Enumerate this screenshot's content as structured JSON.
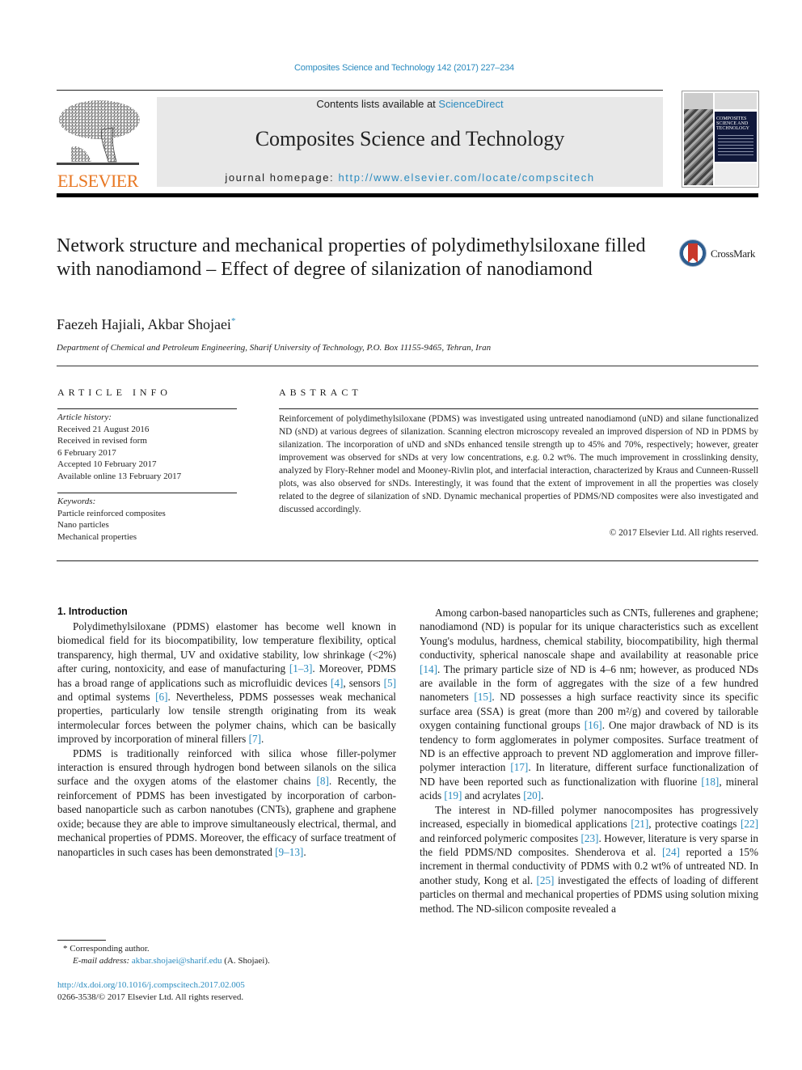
{
  "header": {
    "journal_reference": "Composites Science and Technology 142 (2017) 227–234",
    "publisher_logo_text": "ELSEVIER",
    "contents_prefix": "Contents lists available at ",
    "contents_link": "ScienceDirect",
    "journal_name": "Composites Science and Technology",
    "homepage_prefix": "journal homepage: ",
    "homepage_url": "http://www.elsevier.com/locate/compscitech",
    "cover_title": "COMPOSITES SCIENCE AND TECHNOLOGY"
  },
  "article": {
    "title": "Network structure and mechanical properties of polydimethylsiloxane filled with nanodiamond – Effect of degree of silanization of nanodiamond",
    "crossmark_label": "CrossMark",
    "authors": "Faezeh Hajiali, Akbar Shojaei",
    "author_mark": "*",
    "affiliation": "Department of Chemical and Petroleum Engineering, Sharif University of Technology, P.O. Box 11155-9465, Tehran, Iran"
  },
  "article_info": {
    "heading": "ARTICLE INFO",
    "history_label": "Article history:",
    "history": [
      "Received 21 August 2016",
      "Received in revised form",
      "6 February 2017",
      "Accepted 10 February 2017",
      "Available online 13 February 2017"
    ],
    "keywords_label": "Keywords:",
    "keywords": [
      "Particle reinforced composites",
      "Nano particles",
      "Mechanical properties"
    ]
  },
  "abstract": {
    "heading": "ABSTRACT",
    "text": "Reinforcement of polydimethylsiloxane (PDMS) was investigated using untreated nanodiamond (uND) and silane functionalized ND (sND) at various degrees of silanization. Scanning electron microscopy revealed an improved dispersion of ND in PDMS by silanization. The incorporation of uND and sNDs enhanced tensile strength up to 45% and 70%, respectively; however, greater improvement was observed for sNDs at very low concentrations, e.g. 0.2 wt%. The much improvement in crosslinking density, analyzed by Flory-Rehner model and Mooney-Rivlin plot, and interfacial interaction, characterized by Kraus and Cunneen-Russell plots, was also observed for sNDs. Interestingly, it was found that the extent of improvement in all the properties was closely related to the degree of silanization of sND. Dynamic mechanical properties of PDMS/ND composites were also investigated and discussed accordingly.",
    "copyright": "© 2017 Elsevier Ltd. All rights reserved."
  },
  "body": {
    "section_heading": "1.  Introduction",
    "col1_paragraphs": [
      [
        {
          "t": "Polydimethylsiloxane (PDMS) elastomer has become well known in biomedical field for its biocompatibility, low temperature flexibility, optical transparency, high thermal, UV and oxidative stability, low shrinkage (<2%) after curing, nontoxicity, and ease of manufacturing "
        },
        {
          "r": "[1–3]"
        },
        {
          "t": ". Moreover, PDMS has a broad range of applications such as microfluidic devices "
        },
        {
          "r": "[4]"
        },
        {
          "t": ", sensors "
        },
        {
          "r": "[5]"
        },
        {
          "t": " and optimal systems "
        },
        {
          "r": "[6]"
        },
        {
          "t": ". Nevertheless, PDMS possesses weak mechanical properties, particularly low tensile strength originating from its weak intermolecular forces between the polymer chains, which can be basically improved by incorporation of mineral fillers "
        },
        {
          "r": "[7]"
        },
        {
          "t": "."
        }
      ],
      [
        {
          "t": "PDMS is traditionally reinforced with silica whose filler-polymer interaction is ensured through hydrogen bond between silanols on the silica surface and the oxygen atoms of the elastomer chains "
        },
        {
          "r": "[8]"
        },
        {
          "t": ". Recently, the reinforcement of PDMS has been investigated by incorporation of carbon-based nanoparticle such as carbon nanotubes (CNTs), graphene and graphene oxide; because they are able to improve simultaneously electrical, thermal, and mechanical properties of PDMS. Moreover, the efficacy of surface treatment of nanoparticles in such cases has been demonstrated "
        },
        {
          "r": "[9–13]"
        },
        {
          "t": "."
        }
      ]
    ],
    "col2_paragraphs": [
      [
        {
          "t": "Among carbon-based nanoparticles such as CNTs, fullerenes and graphene; nanodiamond (ND) is popular for its unique characteristics such as excellent Young's modulus, hardness, chemical stability, biocompatibility, high thermal conductivity, spherical nanoscale shape and availability at reasonable price "
        },
        {
          "r": "[14]"
        },
        {
          "t": ". The primary particle size of ND is 4–6 nm; however, as produced NDs are available in the form of aggregates with the size of a few hundred nanometers "
        },
        {
          "r": "[15]"
        },
        {
          "t": ". ND possesses a high surface reactivity since its specific surface area (SSA) is great (more than 200 m²/g) and covered by tailorable oxygen containing functional groups "
        },
        {
          "r": "[16]"
        },
        {
          "t": ". One major drawback of ND is its tendency to form agglomerates in polymer composites. Surface treatment of ND is an effective approach to prevent ND agglomeration and improve filler-polymer interaction "
        },
        {
          "r": "[17]"
        },
        {
          "t": ". In literature, different surface functionalization of ND have been reported such as functionalization with fluorine "
        },
        {
          "r": "[18]"
        },
        {
          "t": ", mineral acids "
        },
        {
          "r": "[19]"
        },
        {
          "t": " and acrylates "
        },
        {
          "r": "[20]"
        },
        {
          "t": "."
        }
      ],
      [
        {
          "t": "The interest in ND-filled polymer nanocomposites has progressively increased, especially in biomedical applications "
        },
        {
          "r": "[21]"
        },
        {
          "t": ", protective coatings "
        },
        {
          "r": "[22]"
        },
        {
          "t": " and reinforced polymeric composites "
        },
        {
          "r": "[23]"
        },
        {
          "t": ". However, literature is very sparse in the field PDMS/ND composites. Shenderova et al. "
        },
        {
          "r": "[24]"
        },
        {
          "t": " reported a 15% increment in thermal conductivity of PDMS with 0.2 wt% of untreated ND. In another study, Kong et al. "
        },
        {
          "r": "[25]"
        },
        {
          "t": " investigated the effects of loading of different particles on thermal and mechanical properties of PDMS using solution mixing method. The ND-silicon composite revealed a"
        }
      ]
    ]
  },
  "footnotes": {
    "corresponding_mark": "*",
    "corresponding_label": "Corresponding author.",
    "email_label": "E-mail address: ",
    "email": "akbar.shojaei@sharif.edu",
    "email_suffix": " (A. Shojaei).",
    "doi_url": "http://dx.doi.org/10.1016/j.compscitech.2017.02.005",
    "issn_copyright": "0266-3538/© 2017 Elsevier Ltd. All rights reserved."
  },
  "colors": {
    "link": "#2a8bbf",
    "elsevier_orange": "#e87722",
    "banner_grey": "#e8e8e8"
  }
}
